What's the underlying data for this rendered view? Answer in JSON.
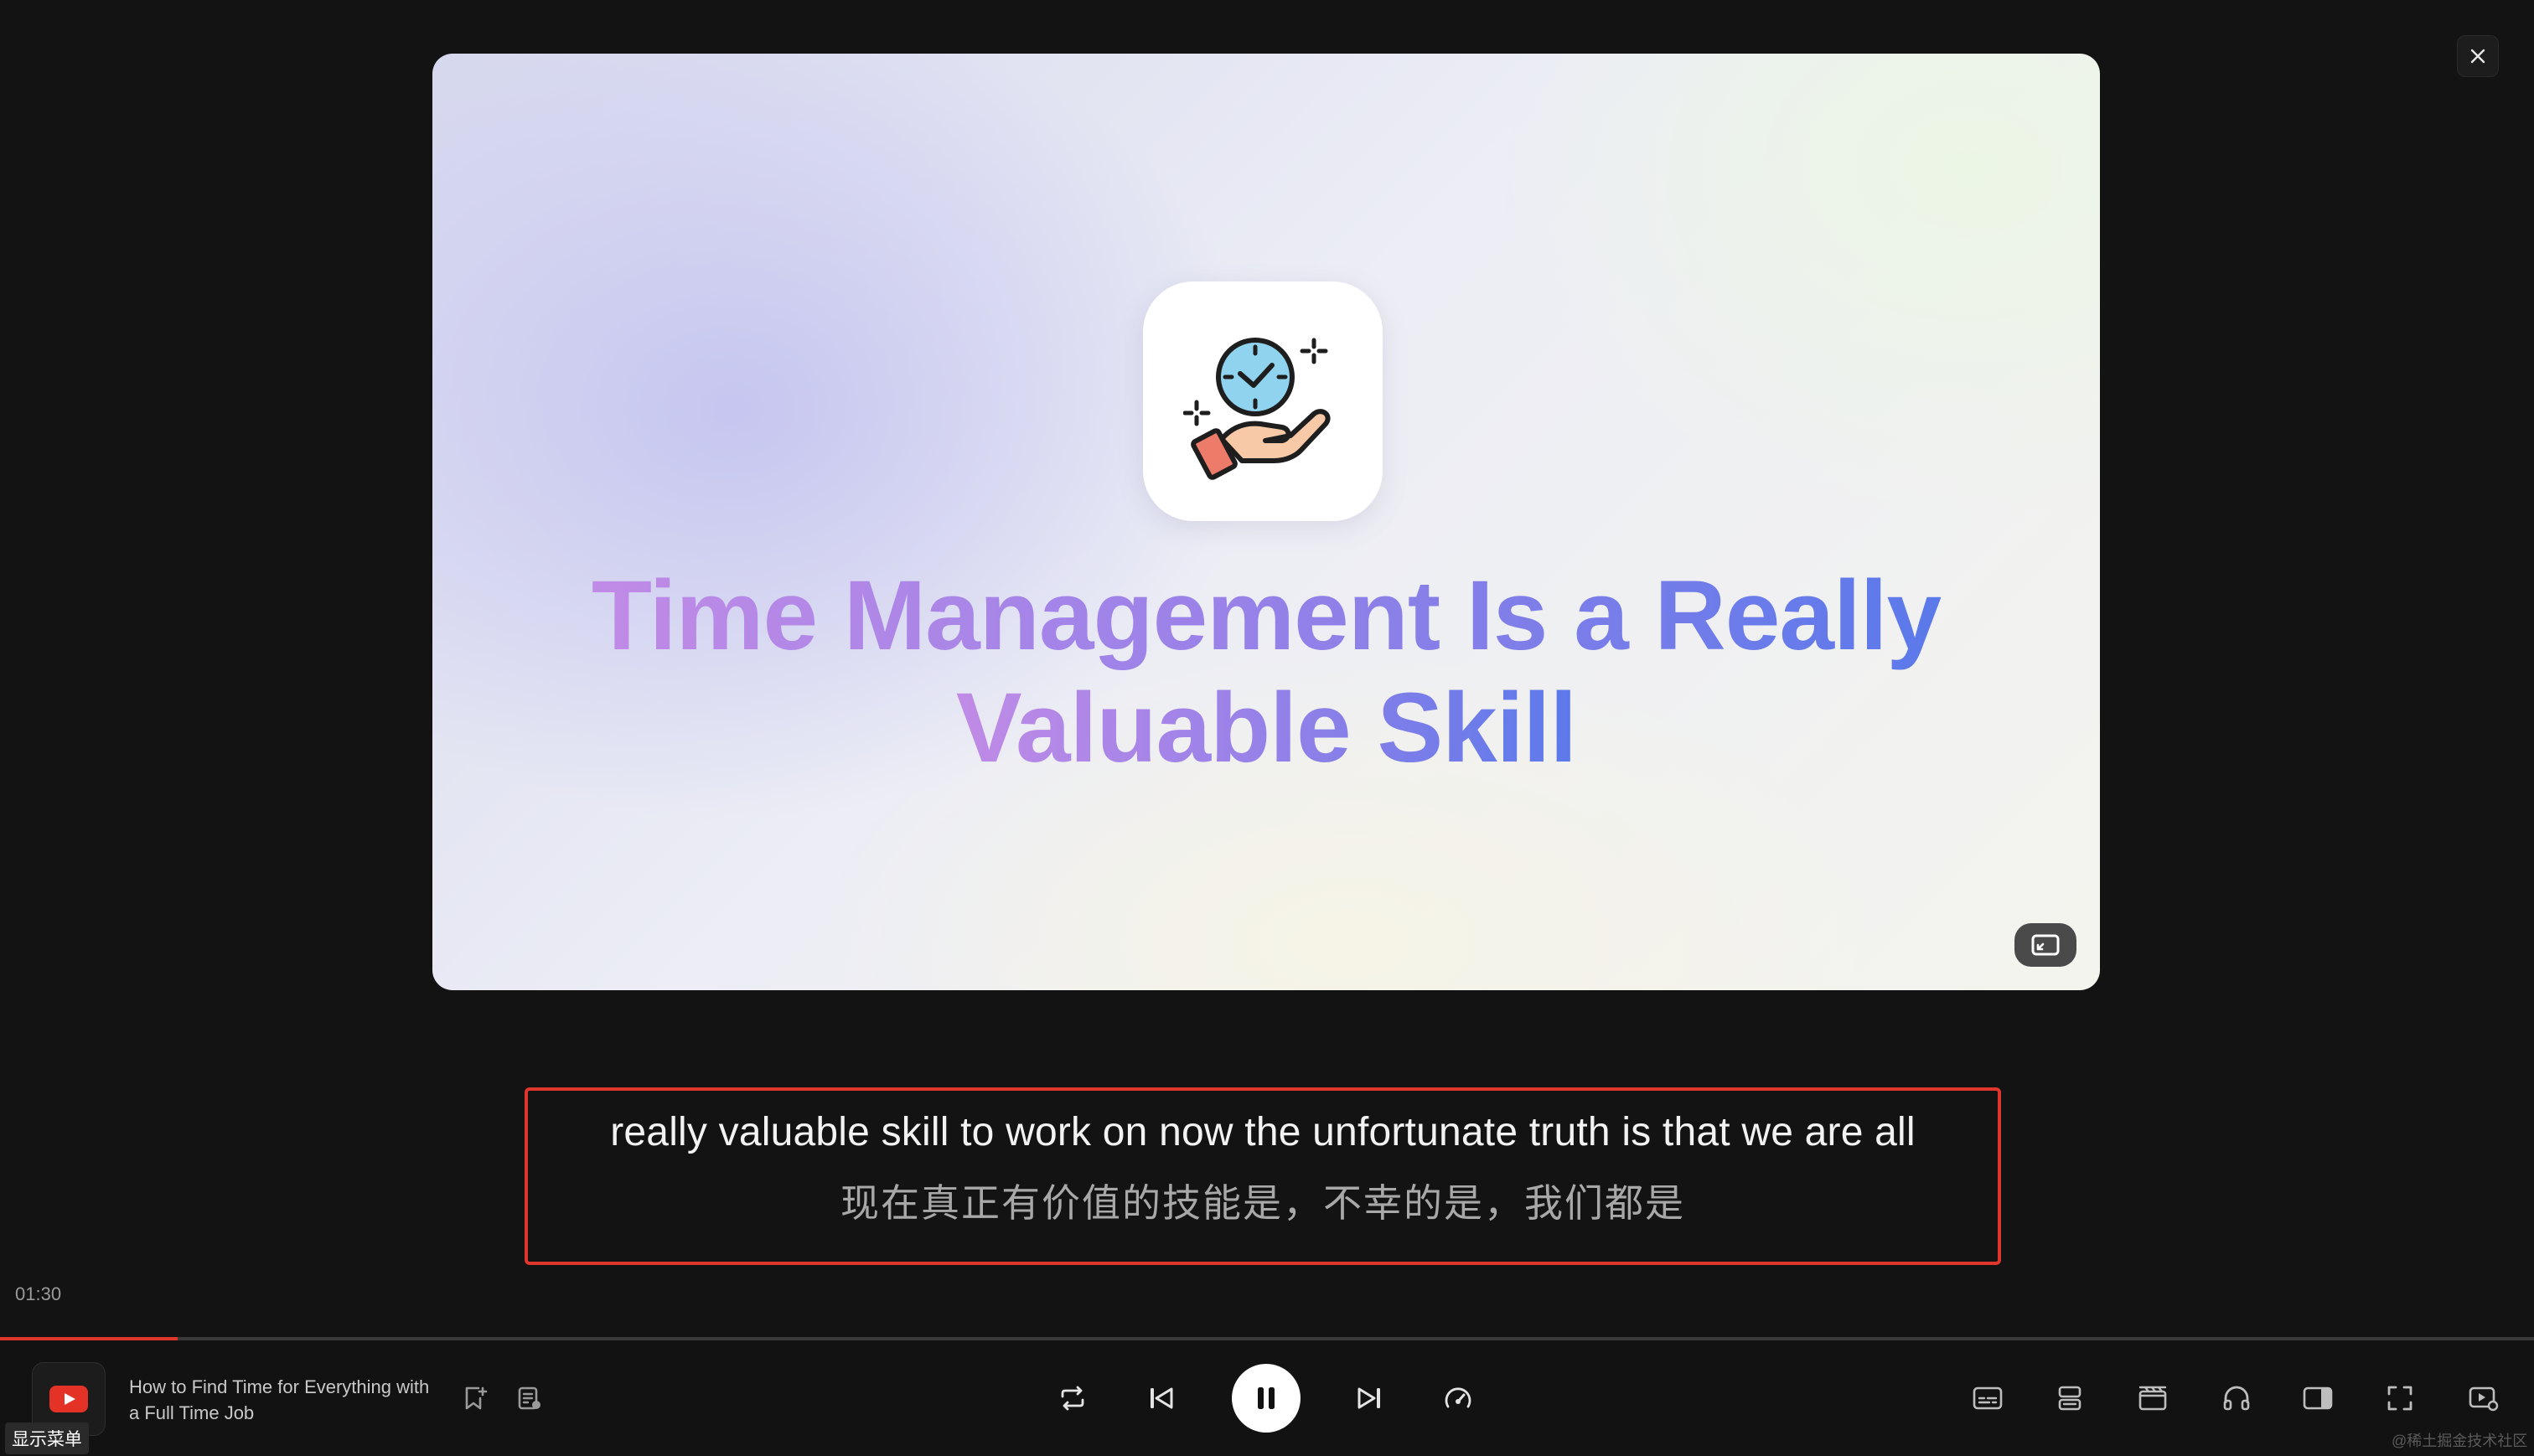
{
  "window": {
    "close_icon": "close-icon"
  },
  "slide": {
    "icon": "time-management-hand-clock-icon",
    "title_line1": "Time Management Is a Really",
    "title_line2": "Valuable Skill"
  },
  "subtitles": {
    "english": "really valuable skill to work on now the unfortunate truth is that we are all",
    "chinese": "现在真正有价值的技能是，不幸的是，我们都是"
  },
  "player": {
    "current_time": "01:30",
    "progress": 0.07,
    "accent_color": "#e0362c",
    "menu_badge": "显示菜单",
    "track_title": "How to Find Time for Everything with a Full Time Job",
    "source_icon": "youtube-icon"
  },
  "watermark": "@稀土掘金技术社区"
}
